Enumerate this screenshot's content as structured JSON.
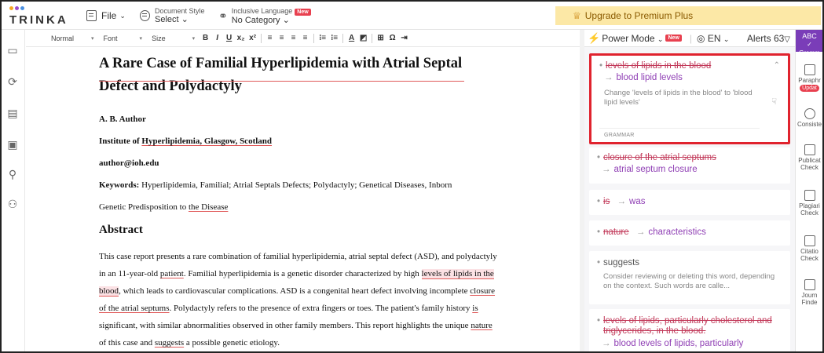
{
  "app": {
    "logo_text": "TRINKA",
    "logo_dot_colors": [
      "#f5a623",
      "#9b4dca",
      "#4a90e2"
    ]
  },
  "topbar": {
    "file_label": "File",
    "doc_style_caption": "Document Style",
    "doc_style_value": "Select",
    "inclusive_caption": "Inclusive Language",
    "inclusive_badge": "New",
    "inclusive_value": "No Category",
    "premium_label": "Upgrade to Premium Plus"
  },
  "toolbar": {
    "style_select": "Normal",
    "font_select": "Font",
    "size_select": "Size",
    "buttons": [
      "B",
      "I",
      "U",
      "x₂",
      "x²",
      "≡",
      "≡",
      "≡",
      "≡",
      "⁝≡",
      "⁝≡",
      "A",
      "◩",
      "⊞",
      "Ω",
      "⇥"
    ]
  },
  "document": {
    "title_line1": "A Rare Case of Familial Hyperlipidemia with Atrial Septal",
    "title_line2": "Defect and Polydactyly",
    "author": "A. B. Author",
    "institute_prefix": "Institute of ",
    "institute_flag": "Hyperlipidemia, Glasgow, Scotland",
    "email": "author@ioh.edu",
    "keywords_label": "Keywords:",
    "keywords_text": " Hyperlipidemia, Familial; Atrial Septals Defects; Polydactyly; Genetical Diseases, Inborn",
    "keywords_cont_prefix": "Genetic Predisposition to ",
    "keywords_cont_flag": "the Disease",
    "abstract_heading": "Abstract",
    "p1": "This case report presents a rare combination of familial hyperlipidemia, atrial septal defect (ASD), and polydactyly",
    "p2a": "in an 11-year-old ",
    "p2b": "patient",
    "p2c": ". Familial hyperlipidemia is a genetic disorder characterized by high ",
    "p2d": "levels of lipids in the",
    "p3a": "blood",
    "p3b": ", which leads to cardiovascular complications. ASD is a congenital heart defect involving incomplete ",
    "p3c": "closure",
    "p4a": "of the atrial septums",
    "p4b": ". Polydactyly refers to the presence of extra fingers or toes. The patient's family history ",
    "p4c": "is",
    "p5a": "significant, with similar abnormalities observed in other family members. This report highlights the unique ",
    "p5b": "nature",
    "p6a": "of this case and ",
    "p6b": "suggests",
    "p6c": " a possible genetic etiology."
  },
  "panel": {
    "power_mode": "Power Mode",
    "power_badge": "New",
    "language": "EN",
    "alerts_label": "Alerts",
    "alerts_count": "63",
    "cards": [
      {
        "original": "levels of lipids in the blood",
        "replacement": "blood lipid levels",
        "description": "Change 'levels of lipids in the blood' to 'blood lipid levels'",
        "category": "GRAMMAR"
      },
      {
        "original": "closure of the atrial septums",
        "replacement": "atrial septum closure"
      },
      {
        "original": "is",
        "replacement": "was"
      },
      {
        "original": "nature",
        "replacement": "characteristics"
      },
      {
        "original": "suggests",
        "description": "Consider reviewing or deleting this word, depending on the context. Such words are calle..."
      },
      {
        "original": "levels of lipids, particularly cholesterol and triglycerides, in the blood.",
        "replacement": "blood levels of lipids, particularly"
      }
    ],
    "highlight_color": "#e0232e"
  },
  "sidebar_right": {
    "top_label": "ABC",
    "top_sub": "Gramm",
    "items": [
      {
        "label1": "Paraphr",
        "badge": "Updat"
      },
      {
        "label1": "Consiste"
      },
      {
        "label1": "Publicat",
        "label2": "Check"
      },
      {
        "label1": "Plagiari",
        "label2": "Check"
      },
      {
        "label1": "Citatio",
        "label2": "Check"
      },
      {
        "label1": "Journ",
        "label2": "Finde"
      }
    ]
  }
}
